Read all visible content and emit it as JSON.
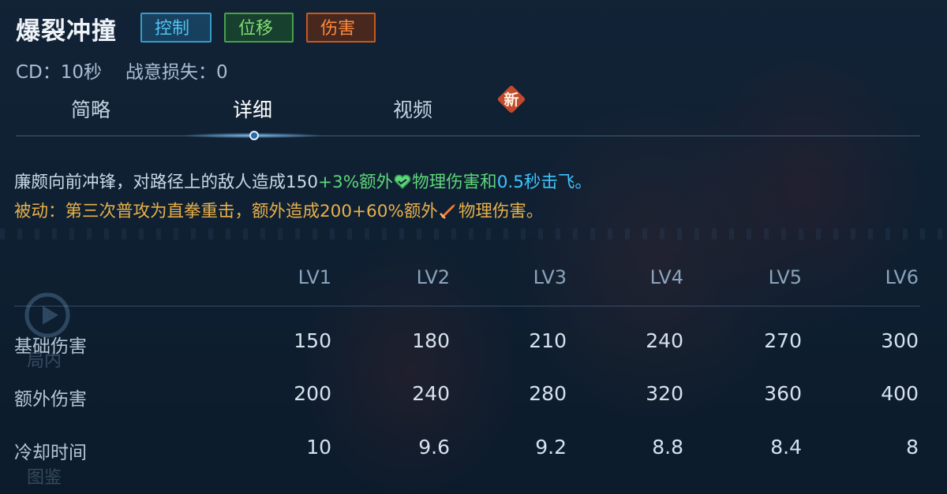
{
  "skill": {
    "name": "爆裂冲撞",
    "tags": [
      "控制",
      "位移",
      "伤害"
    ],
    "cd_label": "CD：10秒",
    "lose_label": "战意损失：0"
  },
  "tabs": {
    "brief": "简略",
    "detail": "详细",
    "video": "视频",
    "new_badge": "新"
  },
  "description": {
    "line1_prefix": "廉颇向前冲锋，对路径上的敌人造成150",
    "line1_bonus": "+3%额外",
    "line1_mid": "物理伤害和",
    "line1_knockup": "0.5秒击飞",
    "line1_end": "。",
    "line2_text": "被动：第三次普攻为直拳重击，额外造成200+60%额外",
    "line2_end": "物理伤害。"
  },
  "table": {
    "levels": [
      "LV1",
      "LV2",
      "LV3",
      "LV4",
      "LV5",
      "LV6"
    ],
    "rows": [
      {
        "label": "基础伤害",
        "values": [
          "150",
          "180",
          "210",
          "240",
          "270",
          "300"
        ]
      },
      {
        "label": "额外伤害",
        "values": [
          "200",
          "240",
          "280",
          "320",
          "360",
          "400"
        ]
      },
      {
        "label": "冷却时间",
        "values": [
          "10",
          "9.6",
          "9.2",
          "8.8",
          "8.4",
          "8"
        ]
      }
    ]
  },
  "sidebar": {
    "item1": "局内",
    "item2": "图鉴"
  },
  "colors": {
    "control": "#51c4f0",
    "move": "#7fdc72",
    "damage": "#ff8a3d",
    "passive": "#e8b04a"
  },
  "icons": [
    "heart-icon",
    "sword-icon",
    "play-icon"
  ]
}
